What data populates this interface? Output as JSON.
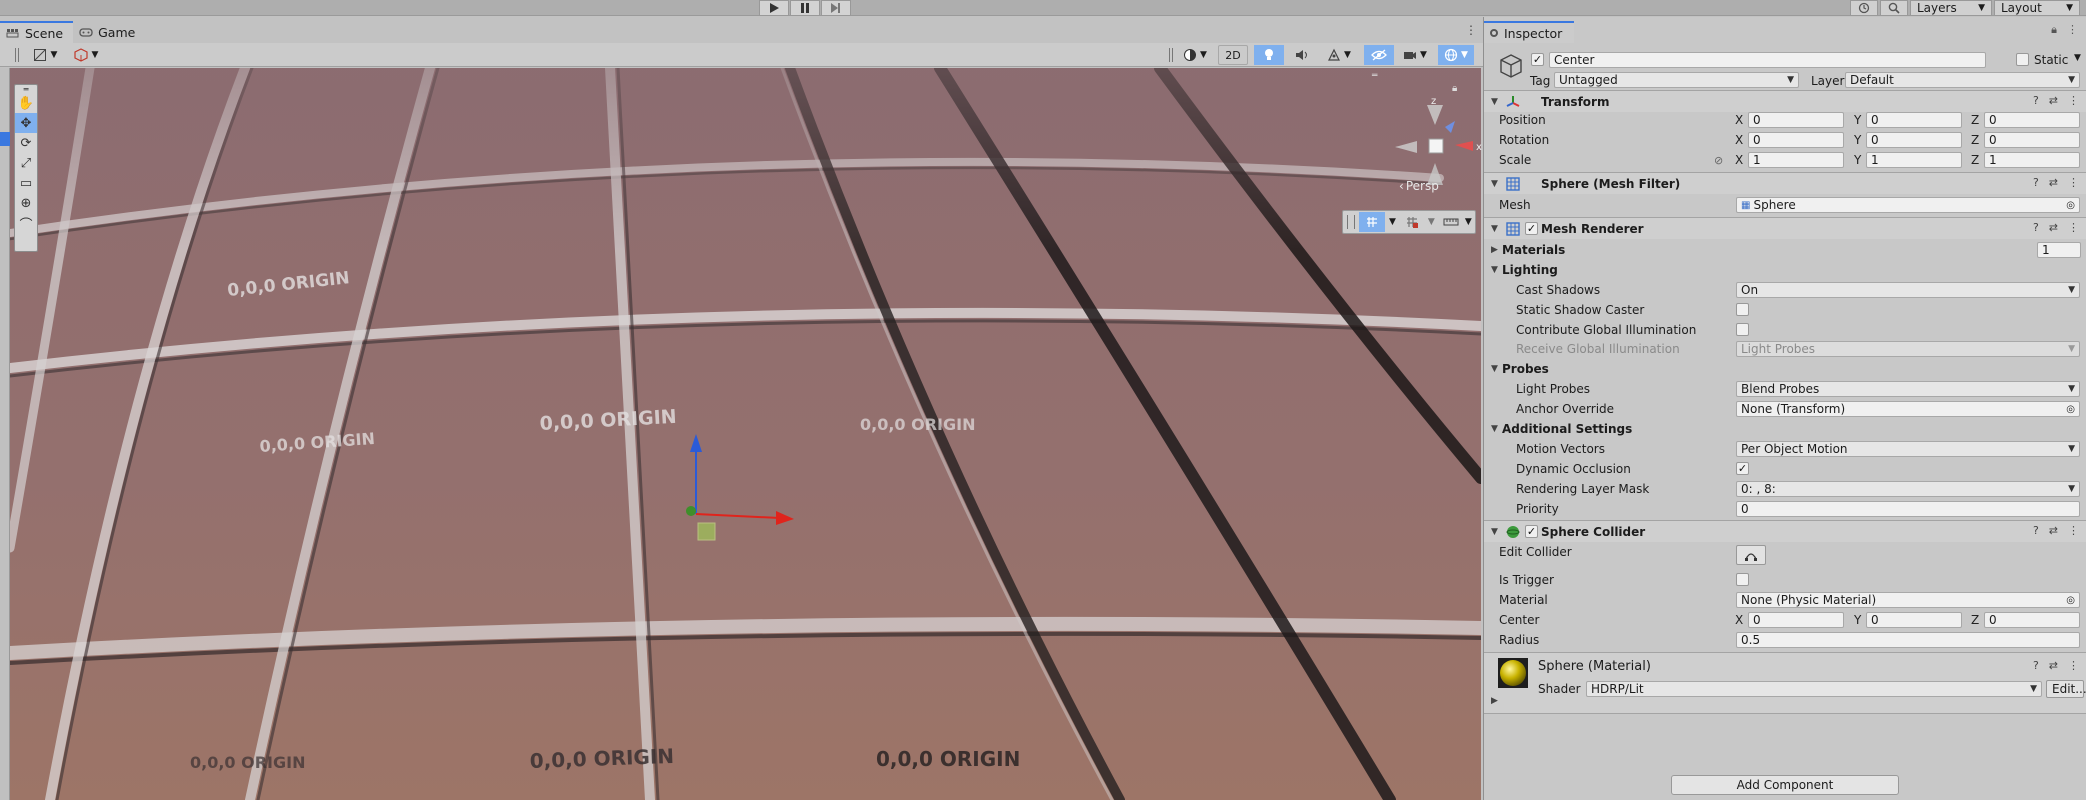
{
  "toolbar": {
    "layers_label": "Layers",
    "layout_label": "Layout"
  },
  "tabs": [
    {
      "label": "Scene"
    },
    {
      "label": "Game"
    }
  ],
  "scene_toolbar": {
    "mode_2d": "2D"
  },
  "viewport": {
    "persp_label": "Persp",
    "grid_text": "0,0,0 ORIGIN",
    "axis_x": "x",
    "axis_z": "z"
  },
  "inspector": {
    "tab_label": "Inspector",
    "object_name": "Center",
    "static_label": "Static",
    "tag_label": "Tag",
    "tag_value": "Untagged",
    "layer_label": "Layer",
    "layer_value": "Default",
    "transform": {
      "title": "Transform",
      "position_label": "Position",
      "rotation_label": "Rotation",
      "scale_label": "Scale",
      "position": {
        "x": "0",
        "y": "0",
        "z": "0"
      },
      "rotation": {
        "x": "0",
        "y": "0",
        "z": "0"
      },
      "scale": {
        "x": "1",
        "y": "1",
        "z": "1"
      }
    },
    "axes": {
      "x": "X",
      "y": "Y",
      "z": "Z"
    },
    "mesh_filter": {
      "title": "Sphere (Mesh Filter)",
      "mesh_label": "Mesh",
      "mesh_value": "Sphere"
    },
    "mesh_renderer": {
      "title": "Mesh Renderer",
      "materials_label": "Materials",
      "materials_count": "1",
      "lighting_label": "Lighting",
      "cast_shadows_label": "Cast Shadows",
      "cast_shadows_value": "On",
      "static_shadow_label": "Static Shadow Caster",
      "contribute_gi_label": "Contribute Global Illumination",
      "receive_gi_label": "Receive Global Illumination",
      "receive_gi_value": "Light Probes",
      "probes_label": "Probes",
      "light_probes_label": "Light Probes",
      "light_probes_value": "Blend Probes",
      "anchor_label": "Anchor Override",
      "anchor_value": "None (Transform)",
      "additional_label": "Additional Settings",
      "motion_vectors_label": "Motion Vectors",
      "motion_vectors_value": "Per Object Motion",
      "dynamic_occlusion_label": "Dynamic Occlusion",
      "rendering_layer_label": "Rendering Layer Mask",
      "rendering_layer_value": "0: , 8:",
      "priority_label": "Priority",
      "priority_value": "0"
    },
    "sphere_collider": {
      "title": "Sphere Collider",
      "edit_collider_label": "Edit Collider",
      "is_trigger_label": "Is Trigger",
      "material_label": "Material",
      "material_value": "None (Physic Material)",
      "center_label": "Center",
      "center": {
        "x": "0",
        "y": "0",
        "z": "0"
      },
      "radius_label": "Radius",
      "radius_value": "0.5"
    },
    "material": {
      "title": "Sphere (Material)",
      "shader_label": "Shader",
      "shader_value": "HDRP/Lit",
      "edit_label": "Edit..."
    },
    "add_component_label": "Add Component"
  },
  "colors": {
    "accent": "#3a78e0",
    "selected_tool": "#7fb0ee",
    "viewport_floor": "#94706e",
    "handle_x": "#e0241c",
    "handle_y": "#2a5bd8",
    "handle_center": "#9fc25a"
  }
}
